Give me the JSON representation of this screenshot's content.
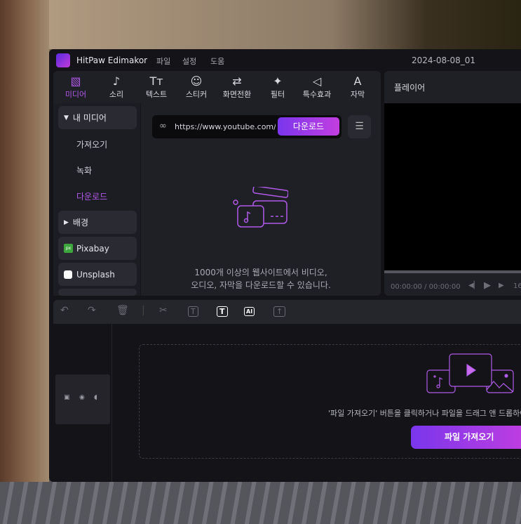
{
  "app": {
    "name": "HitPaw Edimakor",
    "menu": [
      "파일",
      "설정",
      "도움"
    ],
    "project": "2024-08-08_01"
  },
  "toolbar": [
    {
      "label": "미디어",
      "icon": "media-icon"
    },
    {
      "label": "소리",
      "icon": "music-note-icon"
    },
    {
      "label": "텍스트",
      "icon": "text-icon"
    },
    {
      "label": "스티커",
      "icon": "sticker-icon"
    },
    {
      "label": "화면전환",
      "icon": "transition-icon"
    },
    {
      "label": "필터",
      "icon": "sparkle-icon"
    },
    {
      "label": "특수효과",
      "icon": "effect-icon"
    },
    {
      "label": "자막",
      "icon": "subtitle-icon"
    }
  ],
  "sidebar": {
    "my_media": "내 미디어",
    "import": "가져오기",
    "record": "녹화",
    "download": "다운로드",
    "background": "배경",
    "pixabay": "Pixabay",
    "pixabay_badge": "px",
    "unsplash": "Unsplash"
  },
  "download": {
    "url": "https://www.youtube.com/wat",
    "button": "다운로드",
    "desc1": "1000개 이상의 웹사이트에서 비디오,",
    "desc2": "오디오, 자막을 다운로드할 수 있습니다."
  },
  "player": {
    "title": "플레이어",
    "time": "00:00:00 / 00:00:00",
    "speed": "16"
  },
  "timeline": {
    "hint": "'파일 가져오기' 버튼을 클릭하거나 파일을 드래그 앤 드롭하여",
    "import_button": "파일 가져오기",
    "ai_label": "AI"
  },
  "colors": {
    "accent": "#b05ae8",
    "bg": "#131318",
    "panel": "#1f1f26"
  }
}
